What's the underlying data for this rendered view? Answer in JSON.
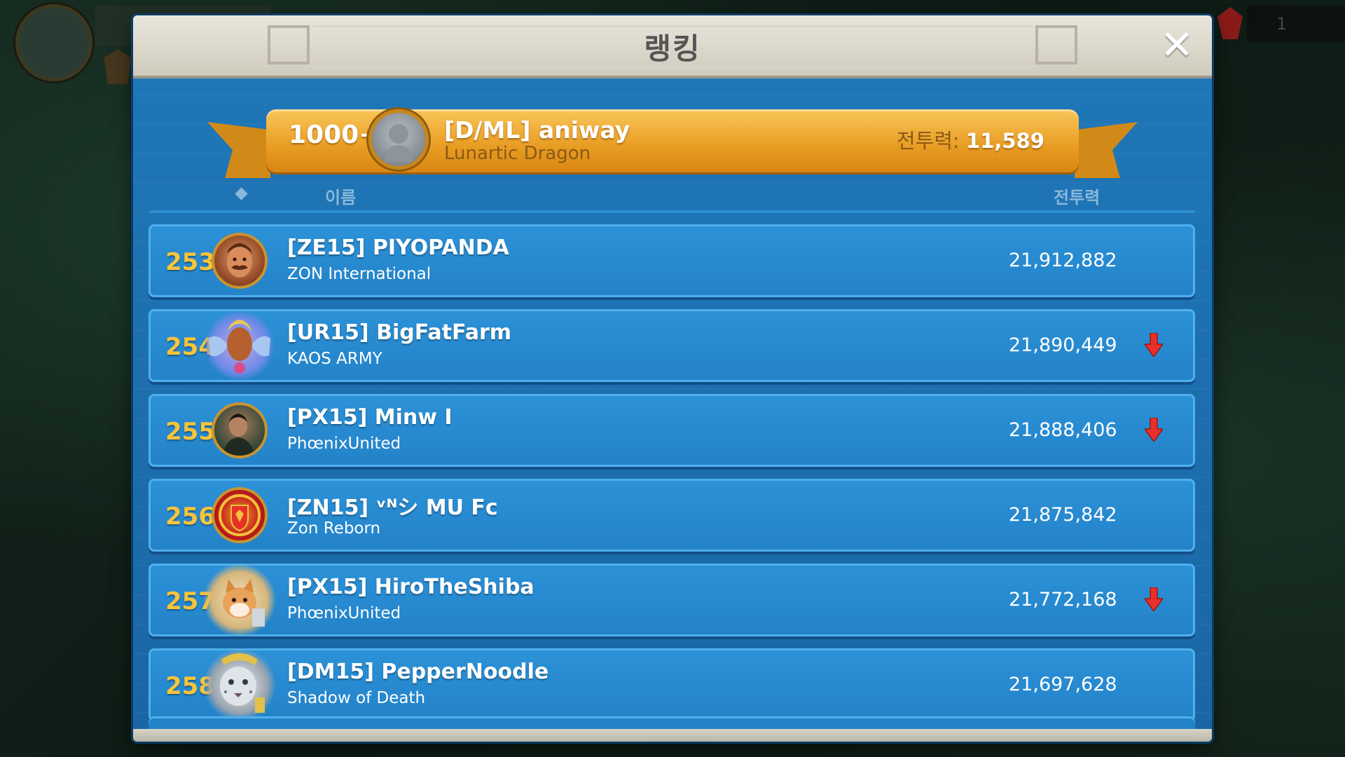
{
  "dialog": {
    "title": "랭킹",
    "close_label": "✕"
  },
  "me": {
    "rank": "1000+",
    "name": "[D/ML] aniway",
    "alliance": "Lunartic Dragon",
    "power_label": "전투력:",
    "power_value": "11,589"
  },
  "columns": {
    "name": "이름",
    "power": "전투력"
  },
  "rows": [
    {
      "rank": "253",
      "name": "[ZE15] PIYOPANDA",
      "alliance": "ZON International",
      "power": "21,912,882",
      "trend": "none"
    },
    {
      "rank": "254",
      "name": "[UR15] BigFatFarm",
      "alliance": "KAOS ARMY",
      "power": "21,890,449",
      "trend": "down"
    },
    {
      "rank": "255",
      "name": "[PX15] Minw I",
      "alliance": "PhœnixUnited",
      "power": "21,888,406",
      "trend": "down"
    },
    {
      "rank": "256",
      "name": "[ZN15] ᵛᴺシ MU Fc",
      "alliance": "Zon Reborn",
      "power": "21,875,842",
      "trend": "none"
    },
    {
      "rank": "257",
      "name": "[PX15] HiroTheShiba",
      "alliance": "PhœnixUnited",
      "power": "21,772,168",
      "trend": "down"
    },
    {
      "rank": "258",
      "name": "[DM15] PepperNoodle",
      "alliance": "Shadow of Death",
      "power": "21,697,628",
      "trend": "none"
    }
  ],
  "background": {
    "counter": "1"
  },
  "colors": {
    "rank_gold": "#f7c43a",
    "row_blue": "#2382c8",
    "banner_orange": "#e89c22",
    "down_arrow": "#e8302a"
  }
}
